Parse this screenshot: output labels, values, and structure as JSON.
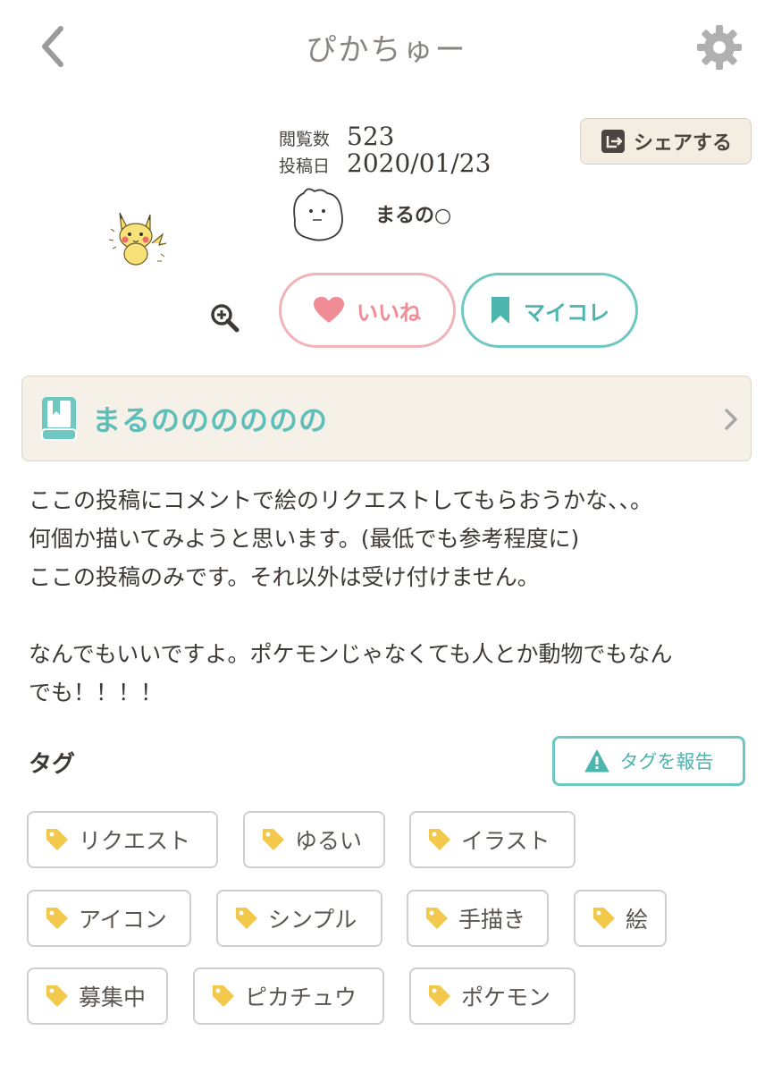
{
  "header": {
    "title": "ぴかちゅー"
  },
  "meta": {
    "views_label": "閲覧数",
    "views_value": "523",
    "posted_label": "投稿日",
    "posted_value": "2020/01/23"
  },
  "share": {
    "label": "シェアする"
  },
  "user": {
    "name": "まるの○"
  },
  "actions": {
    "like_label": "いいね",
    "mycolle_label": "マイコレ"
  },
  "collection": {
    "title": "まるのののののの"
  },
  "description": "ここの投稿にコメントで絵のリクエストしてもらおうかな、、。\n何個か描いてみようと思います。(最低でも参考程度に)\nここの投稿のみです。それ以外は受け付けません。\n\nなんでもいいですよ。ポケモンじゃなくても人とか動物でもなん\nでも！！！！",
  "tags": {
    "heading": "タグ",
    "report_label": "タグを報告",
    "items": [
      {
        "label": "リクエスト"
      },
      {
        "label": "ゆるい"
      },
      {
        "label": "イラスト"
      },
      {
        "label": "アイコン"
      },
      {
        "label": "シンプル"
      },
      {
        "label": "手描き"
      },
      {
        "label": "絵"
      },
      {
        "label": "募集中"
      },
      {
        "label": "ピカチュウ"
      },
      {
        "label": "ポケモン"
      }
    ]
  },
  "colors": {
    "accent_teal": "#6ec8c2",
    "like_pink": "#f0b4b8",
    "tag_yellow": "#f2c94c",
    "text_dark": "#3e3935"
  }
}
